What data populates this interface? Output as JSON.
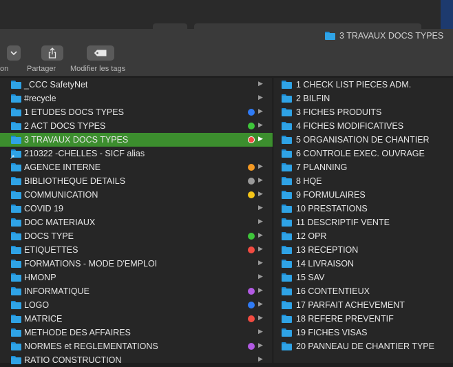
{
  "window": {
    "title": "3 TRAVAUX DOCS TYPES"
  },
  "toolbar": {
    "view_label": "on",
    "share_label": "Partager",
    "tags_label": "Modifier les tags"
  },
  "left_column": [
    {
      "label": "_CCC SafetyNet",
      "tag": null
    },
    {
      "label": "#recycle",
      "tag": null
    },
    {
      "label": "1 ETUDES DOCS TYPES",
      "tag": "#2f7bf5"
    },
    {
      "label": "2 ACT DOCS TYPES",
      "tag": "#3ec53a"
    },
    {
      "label": "3 TRAVAUX DOCS TYPES",
      "tag": "#f24b41",
      "selected": true
    },
    {
      "label": "210322 -CHELLES - SICF alias",
      "tag": null,
      "alias": true
    },
    {
      "label": "AGENCE INTERNE",
      "tag": "#f59a23"
    },
    {
      "label": "BIBLIOTHEQUE DETAILS",
      "tag": "#9a9a9a"
    },
    {
      "label": "COMMUNICATION",
      "tag": "#f5c518"
    },
    {
      "label": "COVID 19",
      "tag": null
    },
    {
      "label": "DOC MATERIAUX",
      "tag": null
    },
    {
      "label": "DOCS TYPE",
      "tag": "#3ec53a"
    },
    {
      "label": "ETIQUETTES",
      "tag": "#f24b41"
    },
    {
      "label": "FORMATIONS - MODE D'EMPLOI",
      "tag": null
    },
    {
      "label": "HMONP",
      "tag": null
    },
    {
      "label": "INFORMATIQUE",
      "tag": "#b25ae3"
    },
    {
      "label": "LOGO",
      "tag": "#2f7bf5"
    },
    {
      "label": "MATRICE",
      "tag": "#f24b41"
    },
    {
      "label": "METHODE DES AFFAIRES",
      "tag": null
    },
    {
      "label": "NORMES et REGLEMENTATIONS",
      "tag": "#b25ae3"
    },
    {
      "label": "RATIO CONSTRUCTION",
      "tag": null
    }
  ],
  "right_column": [
    "1 CHECK LIST PIECES ADM.",
    "2 BILFIN",
    "3 FICHES PRODUITS",
    "4 FICHES MODIFICATIVES",
    "5 ORGANISATION DE CHANTIER",
    "6 CONTROLE EXEC. OUVRAGE",
    "7 PLANNING",
    "8 HQE",
    "9 FORMULAIRES",
    "10 PRESTATIONS",
    "11 DESCRIPTIF VENTE",
    "12 OPR",
    "13 RECEPTION",
    "14 LIVRAISON",
    "15 SAV",
    "16 CONTENTIEUX",
    "17 PARFAIT ACHEVEMENT",
    "18 REFERE PREVENTIF",
    "19 FICHES VISAS",
    "20 PANNEAU DE CHANTIER TYPE"
  ]
}
